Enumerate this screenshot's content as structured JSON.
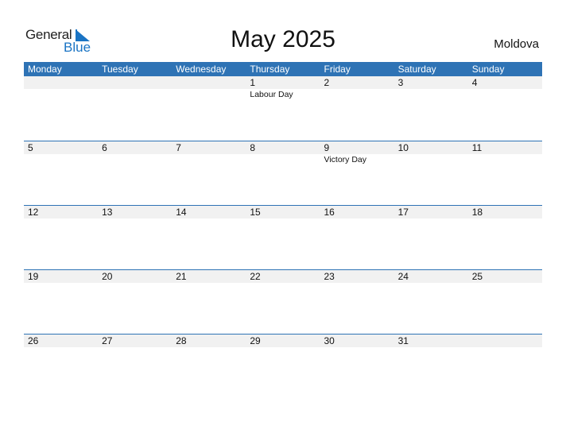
{
  "logo": {
    "general": "General",
    "blue": "Blue"
  },
  "title": "May 2025",
  "country": "Moldova",
  "colors": {
    "header_bg": "#2e73b5",
    "day_row_bg": "#f1f1f1",
    "logo_blue": "#1a74c4"
  },
  "weekdays": [
    "Monday",
    "Tuesday",
    "Wednesday",
    "Thursday",
    "Friday",
    "Saturday",
    "Sunday"
  ],
  "weeks": [
    {
      "days": [
        "",
        "",
        "",
        "1",
        "2",
        "3",
        "4"
      ],
      "events": [
        "",
        "",
        "",
        "Labour Day",
        "",
        "",
        ""
      ]
    },
    {
      "days": [
        "5",
        "6",
        "7",
        "8",
        "9",
        "10",
        "11"
      ],
      "events": [
        "",
        "",
        "",
        "",
        "Victory Day",
        "",
        ""
      ]
    },
    {
      "days": [
        "12",
        "13",
        "14",
        "15",
        "16",
        "17",
        "18"
      ],
      "events": [
        "",
        "",
        "",
        "",
        "",
        "",
        ""
      ]
    },
    {
      "days": [
        "19",
        "20",
        "21",
        "22",
        "23",
        "24",
        "25"
      ],
      "events": [
        "",
        "",
        "",
        "",
        "",
        "",
        ""
      ]
    },
    {
      "days": [
        "26",
        "27",
        "28",
        "29",
        "30",
        "31",
        ""
      ],
      "events": [
        "",
        "",
        "",
        "",
        "",
        "",
        ""
      ]
    }
  ]
}
